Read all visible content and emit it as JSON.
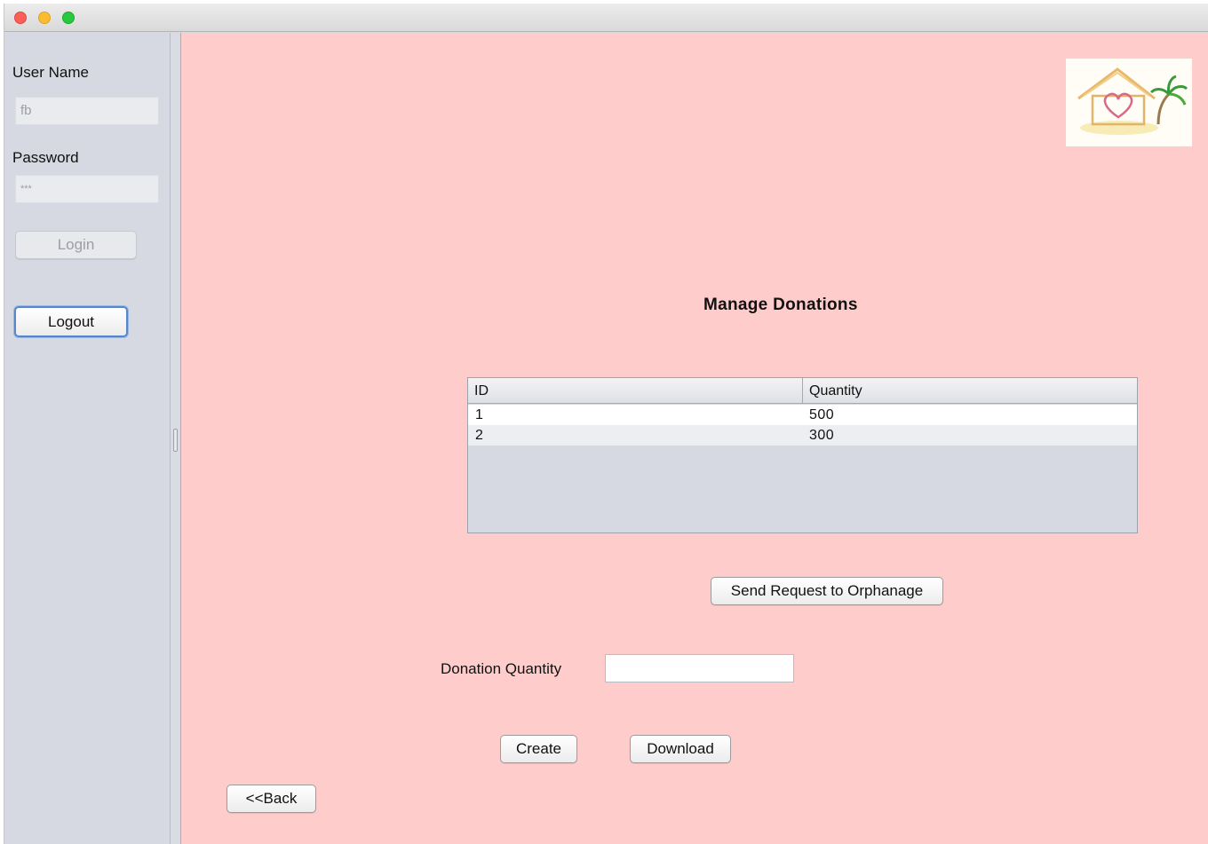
{
  "login": {
    "username_label": "User Name",
    "username_value": "fb",
    "password_label": "Password",
    "password_value": "***",
    "login_button": "Login",
    "logout_button": "Logout"
  },
  "page": {
    "title": "Manage Donations"
  },
  "table": {
    "columns": [
      "ID",
      "Quantity"
    ],
    "rows": [
      {
        "id": "1",
        "quantity": "500"
      },
      {
        "id": "2",
        "quantity": "300"
      }
    ]
  },
  "actions": {
    "send_request": "Send Request to Orphanage",
    "donation_quantity_label": "Donation Quantity",
    "donation_quantity_value": "",
    "create": "Create",
    "download": "Download",
    "back": "<<Back"
  },
  "colors": {
    "main_background": "#ffcccc",
    "sidebar_background": "#d6d9e1"
  },
  "icons": {
    "logo": "orphanage-house-heart-palm-logo"
  }
}
